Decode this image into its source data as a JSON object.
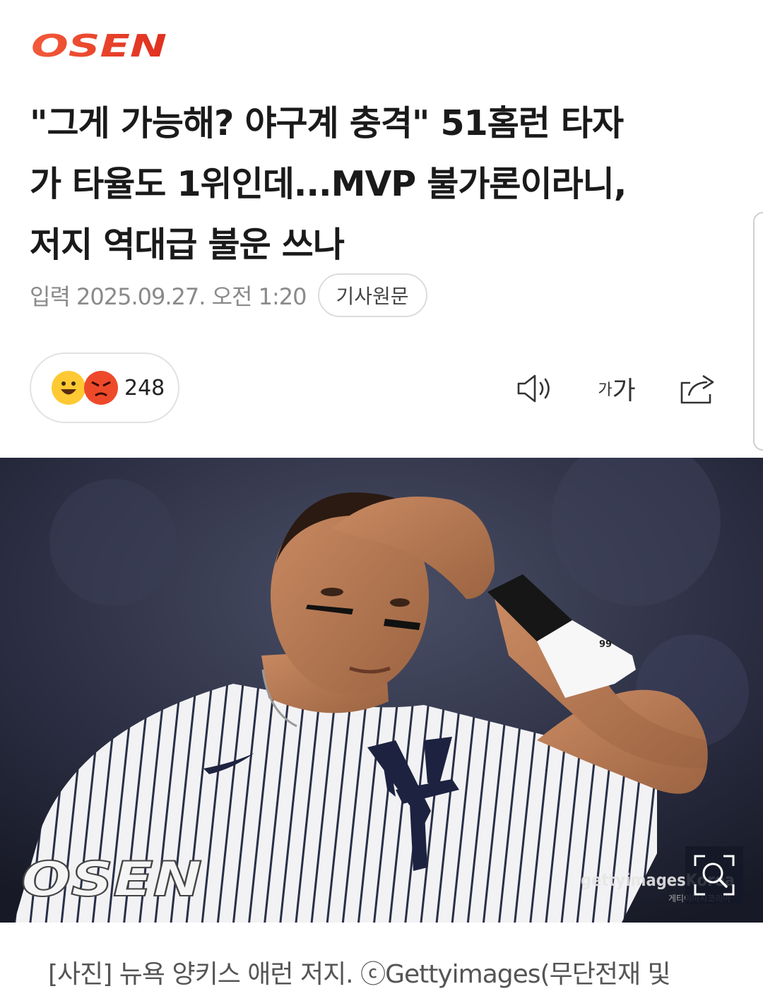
{
  "brand": {
    "logo_text": "OSEN",
    "accent": "#e8452a"
  },
  "article": {
    "headline_lines": [
      "\"그게 가능해? 야구계 충격\" 51홈런 타자",
      "가 타율도 1위인데...MVP 불가론이라니,",
      "저지 역대급 불운 쓰나"
    ],
    "date": "입력 2025.09.27. 오전 1:20",
    "source_button": "기사원문"
  },
  "reactions": {
    "count": "248",
    "icons": [
      "laughing-emoji-icon",
      "angry-emoji-icon"
    ]
  },
  "toolbar": {
    "icons": [
      "speaker-icon",
      "font-size-icon",
      "share-icon"
    ],
    "font_small": "가",
    "font_big": "가"
  },
  "photo": {
    "watermark": "OSEN",
    "credit": "gettyimagesKorea",
    "credit_sub": "게티이미지코리아",
    "jersey_number": "99",
    "zoom_icon": "zoom-icon"
  },
  "caption": "[사진] 뉴욕 양키스 애런 저지. ⓒGettyimages(무단전재 및"
}
